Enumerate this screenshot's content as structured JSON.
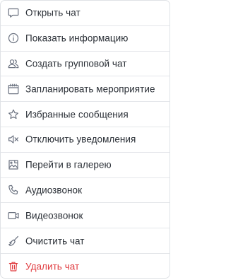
{
  "menu": {
    "items": [
      {
        "label": "Открыть чат",
        "icon": "chat-bubble-icon"
      },
      {
        "label": "Показать информацию",
        "icon": "info-icon"
      },
      {
        "label": "Создать групповой чат",
        "icon": "group-icon"
      },
      {
        "label": "Запланировать мероприятие",
        "icon": "calendar-icon"
      },
      {
        "label": "Избранные сообщения",
        "icon": "star-icon"
      },
      {
        "label": "Отключить уведомления",
        "icon": "mute-icon"
      },
      {
        "label": "Перейти в галерею",
        "icon": "gallery-icon"
      },
      {
        "label": "Аудиозвонок",
        "icon": "phone-icon"
      },
      {
        "label": "Видеозвонок",
        "icon": "video-icon"
      },
      {
        "label": "Очистить чат",
        "icon": "broom-icon"
      },
      {
        "label": "Удалить чат",
        "icon": "trash-icon"
      }
    ]
  },
  "colors": {
    "text": "#2a2f36",
    "icon": "#6b7280",
    "danger": "#e03a3e",
    "divider": "#e4e6ea",
    "border": "#dfe2e6"
  }
}
